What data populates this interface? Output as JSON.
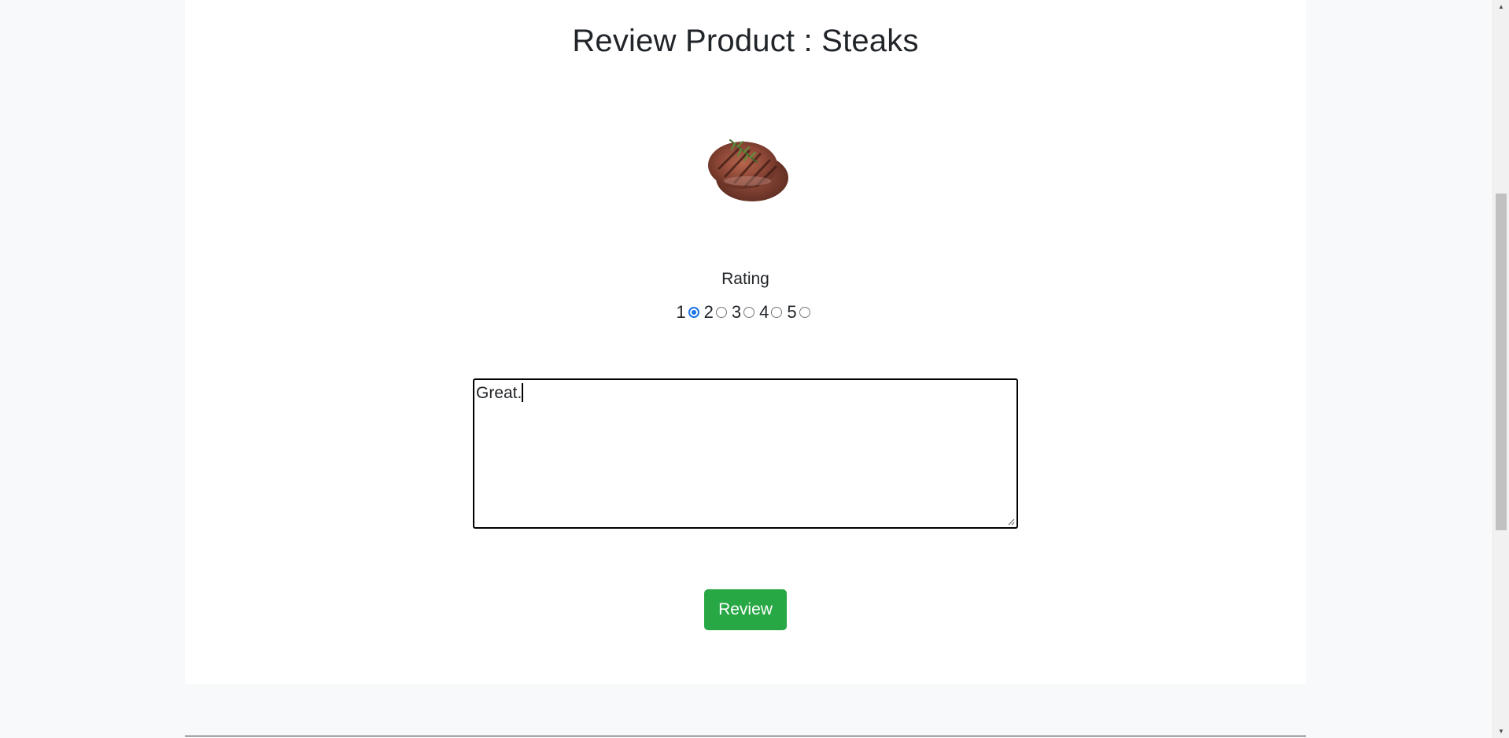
{
  "page": {
    "title": "Review Product : Steaks"
  },
  "product": {
    "image_icon": "steak-image"
  },
  "rating": {
    "label": "Rating",
    "options": [
      "1",
      "2",
      "3",
      "4",
      "5"
    ],
    "selected": "1"
  },
  "review": {
    "text": "Great.",
    "submit_label": "Review"
  },
  "colors": {
    "primary_button": "#28a745",
    "radio_checked": "#1a73e8",
    "page_background": "#f8f9fa",
    "card_background": "#ffffff"
  },
  "scrollbar": {
    "up_icon": "scroll-up-arrow-icon",
    "down_icon": "scroll-down-arrow-icon"
  }
}
